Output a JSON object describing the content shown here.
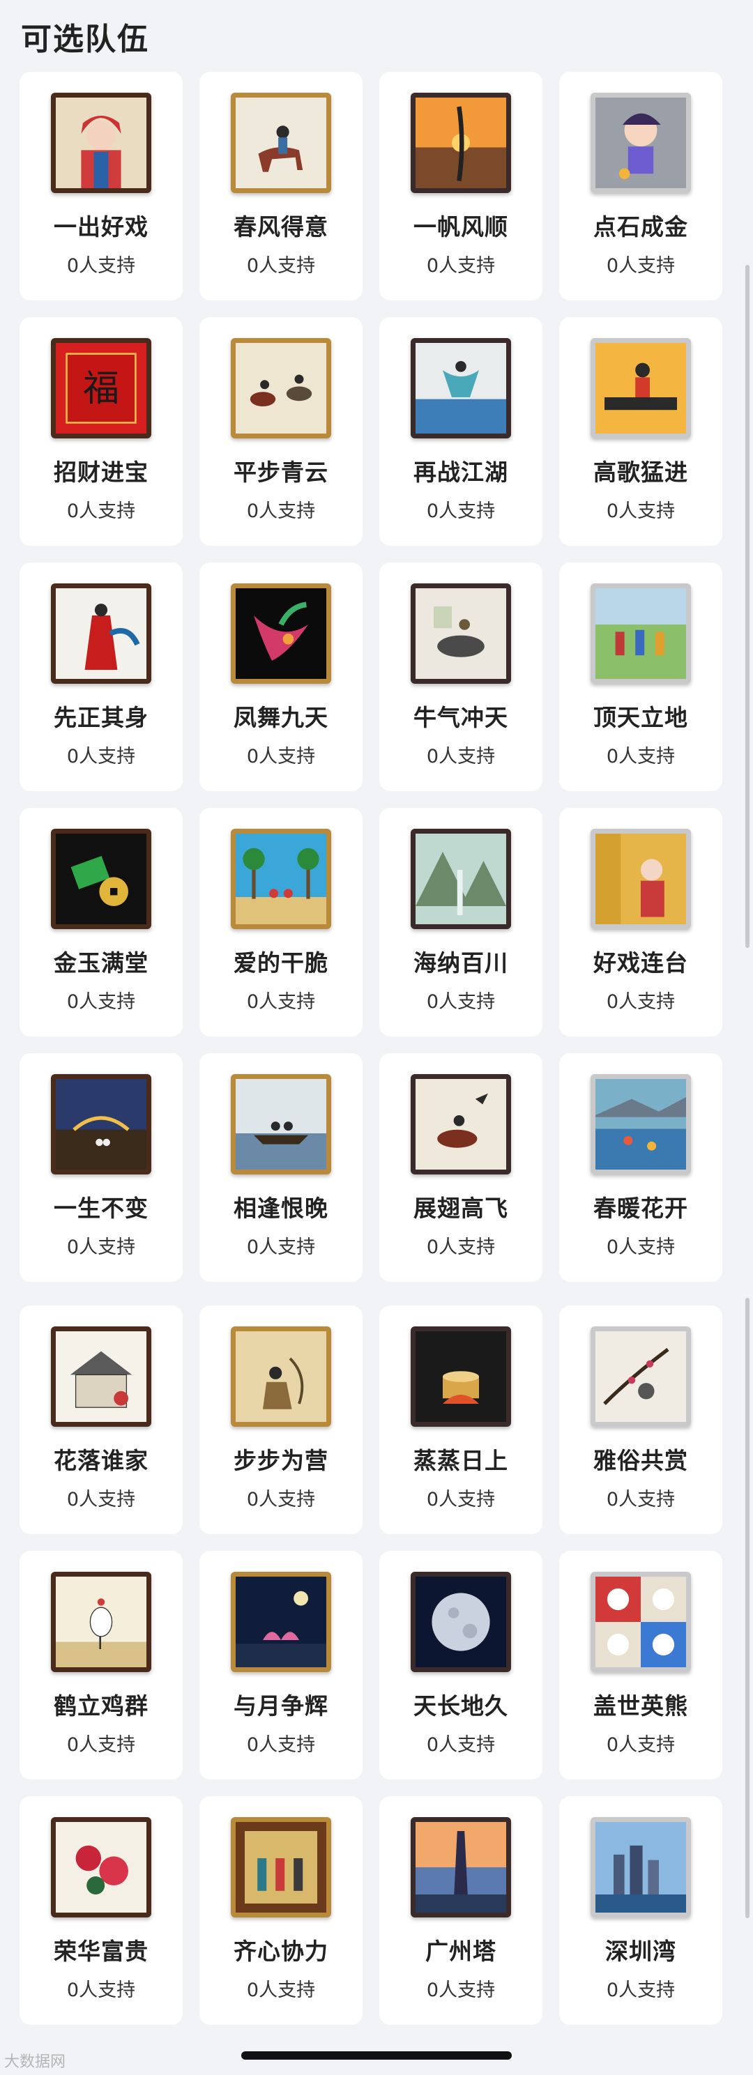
{
  "page_title": "可选队伍",
  "watermark": "大数据网",
  "teams": [
    {
      "name": "一出好戏",
      "support": "0人支持",
      "thumb": "opera-figure"
    },
    {
      "name": "春风得意",
      "support": "0人支持",
      "thumb": "horse-rider"
    },
    {
      "name": "一帆风顺",
      "support": "0人支持",
      "thumb": "sunset-sail"
    },
    {
      "name": "点石成金",
      "support": "0人支持",
      "thumb": "cartoon-girl"
    },
    {
      "name": "招财进宝",
      "support": "0人支持",
      "thumb": "red-fortune"
    },
    {
      "name": "平步青云",
      "support": "0人支持",
      "thumb": "horse-riders"
    },
    {
      "name": "再战江湖",
      "support": "0人支持",
      "thumb": "flying-figure"
    },
    {
      "name": "高歌猛进",
      "support": "0人支持",
      "thumb": "singer"
    },
    {
      "name": "先正其身",
      "support": "0人支持",
      "thumb": "red-robe"
    },
    {
      "name": "凤舞九天",
      "support": "0人支持",
      "thumb": "phoenix"
    },
    {
      "name": "牛气冲天",
      "support": "0人支持",
      "thumb": "ox-rider"
    },
    {
      "name": "顶天立地",
      "support": "0人支持",
      "thumb": "children-field"
    },
    {
      "name": "金玉满堂",
      "support": "0人支持",
      "thumb": "jade-coin"
    },
    {
      "name": "爱的干脆",
      "support": "0人支持",
      "thumb": "palm-hearts"
    },
    {
      "name": "海纳百川",
      "support": "0人支持",
      "thumb": "mountain-waterfall"
    },
    {
      "name": "好戏连台",
      "support": "0人支持",
      "thumb": "opera-curtain"
    },
    {
      "name": "一生不变",
      "support": "0人支持",
      "thumb": "night-couple"
    },
    {
      "name": "相逢恨晚",
      "support": "0人支持",
      "thumb": "boat-meeting"
    },
    {
      "name": "展翅高飞",
      "support": "0人支持",
      "thumb": "rider-bird"
    },
    {
      "name": "春暖花开",
      "support": "0人支持",
      "thumb": "swimmers"
    },
    {
      "name": "花落谁家",
      "support": "0人支持",
      "thumb": "house-sketch"
    },
    {
      "name": "步步为营",
      "support": "0人支持",
      "thumb": "scholars"
    },
    {
      "name": "蒸蒸日上",
      "support": "0人支持",
      "thumb": "steamer"
    },
    {
      "name": "雅俗共赏",
      "support": "0人支持",
      "thumb": "plum-blossom"
    },
    {
      "name": "鹤立鸡群",
      "support": "0人支持",
      "thumb": "crane"
    },
    {
      "name": "与月争辉",
      "support": "0人支持",
      "thumb": "night-lotus"
    },
    {
      "name": "天长地久",
      "support": "0人支持",
      "thumb": "full-moon"
    },
    {
      "name": "盖世英熊",
      "support": "0人支持",
      "thumb": "pandas"
    },
    {
      "name": "荣华富贵",
      "support": "0人支持",
      "thumb": "peonies"
    },
    {
      "name": "齐心协力",
      "support": "0人支持",
      "thumb": "ancient-group"
    },
    {
      "name": "广州塔",
      "support": "0人支持",
      "thumb": "canton-tower"
    },
    {
      "name": "深圳湾",
      "support": "0人支持",
      "thumb": "shenzhen-bay"
    }
  ]
}
